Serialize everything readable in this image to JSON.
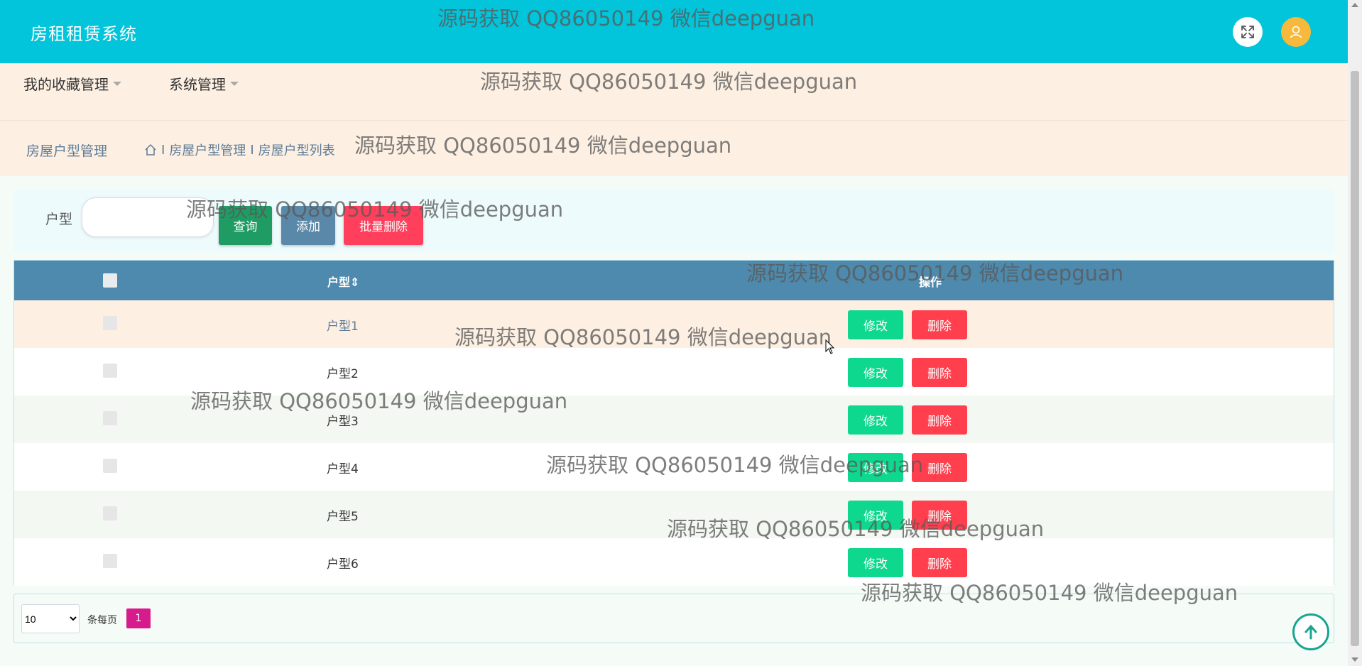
{
  "header": {
    "title": "房租租赁系统"
  },
  "menu": {
    "items": [
      {
        "label": "我的收藏管理"
      },
      {
        "label": "系统管理"
      }
    ]
  },
  "breadcrumb": {
    "title": "房屋户型管理",
    "path": [
      "房屋户型管理",
      "房屋户型列表"
    ],
    "separator": "I"
  },
  "search": {
    "label": "户型",
    "value": "",
    "placeholder": "",
    "search_label": "查询",
    "add_label": "添加",
    "batch_delete_label": "批量删除"
  },
  "table": {
    "columns": [
      "户型",
      "操作"
    ],
    "sort_icon": "⇕",
    "rows": [
      {
        "type": "户型1",
        "highlight": true
      },
      {
        "type": "户型2"
      },
      {
        "type": "户型3"
      },
      {
        "type": "户型4"
      },
      {
        "type": "户型5"
      },
      {
        "type": "户型6"
      }
    ],
    "edit_label": "修改",
    "delete_label": "删除"
  },
  "pagination": {
    "page_size": "10",
    "page_size_options": [
      "10"
    ],
    "per_page_label": "条每页",
    "current_page": "1"
  },
  "watermarks": [
    "源码获取 QQ86050149 微信deepguan",
    "源码获取 QQ86050149 微信deepguan",
    "源码获取 QQ86050149 微信deepguan",
    "源码获取 QQ86050149 微信deepguan",
    "源码获取 QQ86050149 微信deepguan",
    "源码获取 QQ86050149 微信deepguan",
    "源码获取 QQ86050149 微信deepguan",
    "源码获取 QQ86050149 微信deepguan",
    "源码获取 QQ86050149 微信deepguan",
    "源码获取 QQ86050149 微信deepguan"
  ],
  "colors": {
    "header_bg": "#02c4da",
    "menu_bg": "#fdf0e2",
    "table_head_bg": "#4e8aad",
    "edit_button": "#0ed88d",
    "delete_button": "#ff3f4d",
    "page_active": "#d81b8c"
  },
  "icons": {
    "fullscreen": "expand-icon",
    "avatar": "user-icon",
    "home": "home-icon",
    "back_to_top": "arrow-up-icon"
  }
}
